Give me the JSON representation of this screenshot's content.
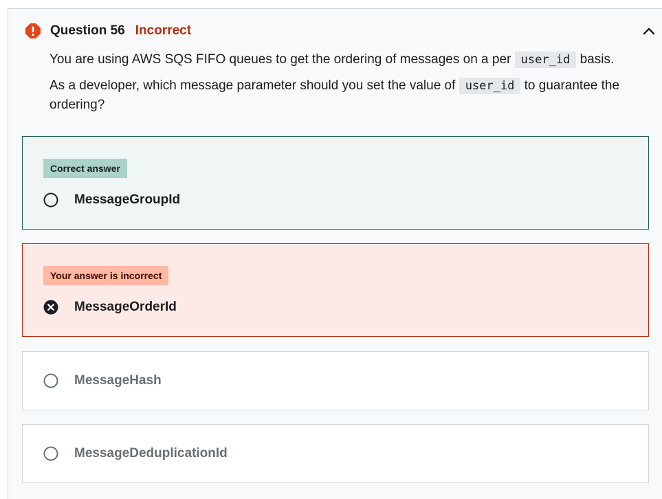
{
  "question": {
    "number_label": "Question 56",
    "status_label": "Incorrect",
    "status_color": "#b32d0f",
    "icon": "alert-icon",
    "text_line1_before": "You are using AWS SQS FIFO queues to get the ordering of messages on a per ",
    "text_line1_code": "user_id",
    "text_line1_after": " basis.",
    "text_line2_before": "As a developer, which message parameter should you set the value of ",
    "text_line2_code": "user_id",
    "text_line2_after": " to guarantee the ordering?"
  },
  "options": [
    {
      "badge": "Correct answer",
      "label": "MessageGroupId",
      "state": "correct",
      "icon": "radio-empty-icon"
    },
    {
      "badge": "Your answer is incorrect",
      "label": "MessageOrderId",
      "state": "incorrect",
      "icon": "x-circle-icon"
    },
    {
      "label": "MessageHash",
      "state": "neutral",
      "icon": "radio-empty-icon"
    },
    {
      "label": "MessageDeduplicationId",
      "state": "neutral",
      "icon": "radio-empty-icon"
    }
  ],
  "colors": {
    "correct_border": "#1e6055",
    "correct_bg": "#f0f6f3",
    "correct_badge": "#acd2cc",
    "incorrect_border": "#b32d0f",
    "incorrect_bg": "#fdeae7",
    "incorrect_badge": "#feb9a0",
    "alert": "#e0461f"
  }
}
